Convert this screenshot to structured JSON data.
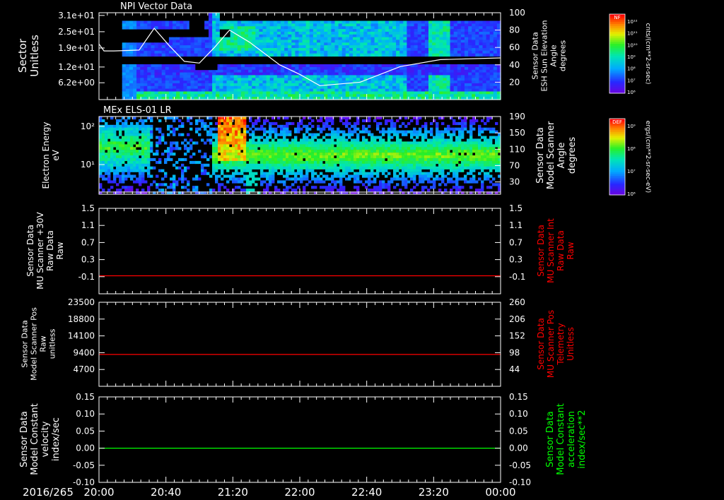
{
  "colors": {
    "background": "#000000",
    "frame": "#ffffff",
    "red_trace": "#ff0000",
    "green_trace": "#00ff00",
    "red_label": "#ff0000",
    "green_label": "#00ff00"
  },
  "date_label": "2016/265",
  "time_ticks": [
    "20:00",
    "20:40",
    "21:20",
    "22:00",
    "22:40",
    "23:20",
    "00:00"
  ],
  "colorbar_npi": {
    "label": "NF",
    "unit": "cnts/(cm**2-sr-sec)",
    "ticks": [
      "10¹²",
      "10¹¹",
      "10¹⁰",
      "10⁹",
      "10⁸",
      "10⁷",
      "10⁶"
    ]
  },
  "colorbar_els": {
    "label": "DEF",
    "unit": "ergs/(cm**2-sr-sec-eV)",
    "ticks": [
      "10⁹",
      "10⁸",
      "10⁷",
      "10⁶"
    ]
  },
  "chart_data": [
    {
      "type": "heatmap",
      "title": "NPI Vector Data",
      "ylabel": [
        "Sector",
        "Unitless"
      ],
      "yticks": [
        "3.1e+01",
        "2.5e+01",
        "1.9e+01",
        "1.2e+01",
        "6.2e+00"
      ],
      "ytick_values": [
        31,
        25,
        19,
        12,
        6.2
      ],
      "ylim": [
        0,
        32
      ],
      "right_ylabel": [
        "Sensor Data",
        "ESH Sun Elevation",
        "Angle",
        "degrees"
      ],
      "right_yticks": [
        "100",
        "80",
        "60",
        "40",
        "20"
      ],
      "right_ylim": [
        0,
        100
      ],
      "overlay_line": {
        "x_hours": [
          20.0,
          20.05,
          20.15,
          20.4,
          20.55,
          20.7,
          20.85,
          21.0,
          21.15,
          21.3,
          21.5,
          21.8,
          22.0,
          22.2,
          22.6,
          23.0,
          23.4,
          24.0
        ],
        "y_deg": [
          64,
          56,
          56,
          57,
          82,
          62,
          44,
          42,
          60,
          80,
          66,
          40,
          29,
          16,
          20,
          38,
          46,
          48
        ]
      }
    },
    {
      "type": "heatmap",
      "title": "MEx ELS-01 LR",
      "ylabel": [
        "Electron Energy",
        "eV"
      ],
      "yticks": [
        "10²",
        "10¹"
      ],
      "right_ylabel": [
        "Sensor Data",
        "Model Scanner",
        "Angle",
        "degrees"
      ],
      "right_yticks": [
        "190",
        "150",
        "110",
        "70",
        "30"
      ],
      "right_ylim": [
        0,
        190
      ]
    },
    {
      "type": "line",
      "ylabel": [
        "Sensor Data",
        "MU Scanner +30V",
        "Raw Data",
        "Raw"
      ],
      "yticks": [
        "1.5",
        "1.1",
        "0.7",
        "0.3",
        "-0.1"
      ],
      "ylim": [
        -0.4,
        1.5
      ],
      "right_ylabel": [
        "Sensor Data",
        "MU Scanner Int",
        "Raw Data",
        "Raw"
      ],
      "right_yticks": [
        "1.5",
        "1.1",
        "0.7",
        "0.3",
        "-0.1"
      ],
      "series": [
        {
          "name": "Sensor Data MU Scanner Int Raw Data",
          "color": "#ff0000",
          "x_hours": [
            20,
            24
          ],
          "values": [
            0,
            0
          ]
        }
      ]
    },
    {
      "type": "line",
      "ylabel": [
        "Sensor Data",
        "Model Scanner Pos",
        "Raw",
        "unitless"
      ],
      "yticks": [
        "23500",
        "18800",
        "14100",
        "9400",
        "4700"
      ],
      "ylim": [
        0,
        23500
      ],
      "right_ylabel": [
        "Sensor Data",
        "MU Scanner Pos",
        "Telemetry",
        "Unitless"
      ],
      "right_yticks": [
        "260",
        "206",
        "152",
        "98",
        "44"
      ],
      "series": [
        {
          "name": "Sensor Data MU Scanner Pos Telemetry",
          "color": "#ff0000",
          "x_hours": [
            20,
            24
          ],
          "values": [
            8900,
            8900
          ]
        }
      ]
    },
    {
      "type": "line",
      "ylabel": [
        "Sensor Data",
        "Model Constant",
        "velocity",
        "index/sec"
      ],
      "yticks": [
        "0.15",
        "0.10",
        "0.05",
        "0.00",
        "-0.05",
        "-0.10"
      ],
      "ylim": [
        -0.1,
        0.15
      ],
      "right_ylabel": [
        "Sensor Data",
        "Model Constant",
        "acceleration",
        "index/sec**2"
      ],
      "right_yticks": [
        "0.15",
        "0.10",
        "0.05",
        "0.00",
        "-0.05",
        "-0.10"
      ],
      "series": [
        {
          "name": "Sensor Data Model Constant acceleration",
          "color": "#00ff00",
          "x_hours": [
            20,
            24
          ],
          "values": [
            0,
            0
          ]
        }
      ]
    }
  ]
}
